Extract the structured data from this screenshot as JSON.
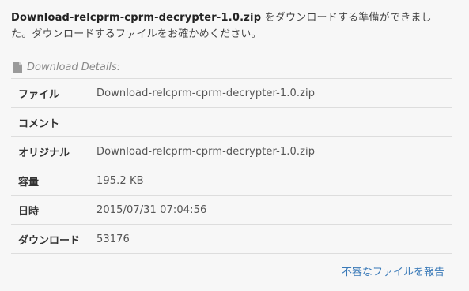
{
  "intro": {
    "filename": "Download-relcprm-cprm-decrypter-1.0.zip",
    "message": " をダウンロードする準備ができました。ダウンロードするファイルをお確かめください。"
  },
  "details": {
    "header": "Download Details:",
    "icon": "file-icon",
    "rows": [
      {
        "label": "ファイル",
        "value": "Download-relcprm-cprm-decrypter-1.0.zip"
      },
      {
        "label": "コメント",
        "value": ""
      },
      {
        "label": "オリジナル",
        "value": "Download-relcprm-cprm-decrypter-1.0.zip"
      },
      {
        "label": "容量",
        "value": "195.2 KB"
      },
      {
        "label": "日時",
        "value": "2015/07/31 07:04:56"
      },
      {
        "label": "ダウンロード",
        "value": "53176"
      }
    ]
  },
  "report_link": "不審なファイルを報告",
  "colors": {
    "link": "#3a7ab8",
    "border": "#dddddd",
    "background": "#f7f7f7"
  }
}
